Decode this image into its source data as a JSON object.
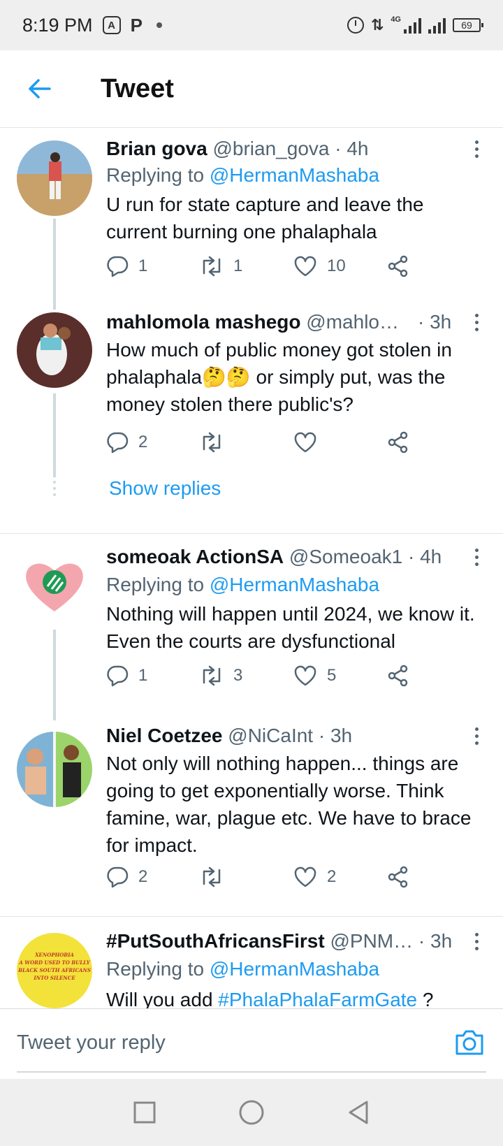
{
  "status_bar": {
    "time": "8:19 PM",
    "network": "4G",
    "battery": "69"
  },
  "header": {
    "title": "Tweet"
  },
  "tweets": [
    {
      "name": "Brian gova",
      "handle": "@brian_gova",
      "time": "· 4h",
      "replying_prefix": "Replying to ",
      "replying_to": "@HermanMashaba",
      "text": "U run for state capture and leave the current burning one phalaphala",
      "replies": "1",
      "retweets": "1",
      "likes": "10"
    },
    {
      "name": "mahlomola mashego",
      "handle": "@mahlo…",
      "time": "· 3h",
      "text": "How much of public money got stolen in phalaphala🤔🤔 or simply put, was the money stolen there public's?",
      "replies": "2",
      "retweets": "",
      "likes": ""
    },
    {
      "name": "someoak ActionSA",
      "handle": "@Someoak1",
      "time": "· 4h",
      "replying_prefix": "Replying to ",
      "replying_to": "@HermanMashaba",
      "text": "Nothing will happen until 2024, we know it. Even the courts are dysfunctional",
      "replies": "1",
      "retweets": "3",
      "likes": "5"
    },
    {
      "name": "Niel Coetzee",
      "handle": "@NiCaInt",
      "time": "· 3h",
      "text": "Not only will nothing happen... things are going to get exponentially worse. Think famine, war, plague etc. We have to brace for impact.",
      "replies": "2",
      "retweets": "",
      "likes": "2"
    },
    {
      "name": "#PutSouthAfricansFirst",
      "handle": "@PNM…",
      "time": "· 3h",
      "replying_prefix": "Replying to ",
      "replying_to": "@HermanMashaba",
      "text_prefix": "Will you add ",
      "hashtag": "#PhalaPhalaFarmGate",
      "text_suffix": " ?",
      "avatar_text": [
        "XENOPHOBIA",
        "A WORD USED TO BULLY",
        "BLACK SOUTH AFRICANS",
        "INTO SILENCE"
      ]
    }
  ],
  "show_replies": "Show replies",
  "reply_bar": {
    "placeholder": "Tweet your reply"
  },
  "colors": {
    "accent": "#1d9bf0",
    "text_primary": "#0f1419",
    "text_secondary": "#536471",
    "divider": "#e3e3e3"
  },
  "icons": [
    "back-arrow-icon",
    "more-icon",
    "reply-icon",
    "retweet-icon",
    "like-icon",
    "share-icon",
    "camera-icon",
    "recent-apps-icon",
    "home-icon",
    "back-icon"
  ]
}
